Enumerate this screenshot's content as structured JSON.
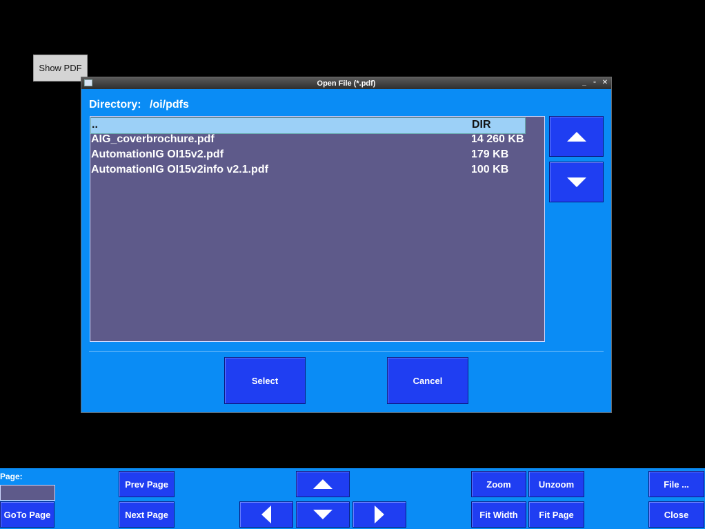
{
  "show_pdf_label": "Show PDF",
  "dialog": {
    "title": "Open File (*.pdf)",
    "directory_label": "Directory:",
    "directory_path": "/oi/pdfs",
    "files": [
      {
        "name": "..",
        "size": "DIR",
        "selected": true
      },
      {
        "name": "AIG_coverbrochure.pdf",
        "size": "14 260 KB"
      },
      {
        "name": "AutomationIG OI15v2.pdf",
        "size": "179 KB"
      },
      {
        "name": "AutomationIG OI15v2info v2.1.pdf",
        "size": "100 KB"
      }
    ],
    "select_label": "Select",
    "cancel_label": "Cancel"
  },
  "bottom_bar": {
    "page_label": "Page:",
    "page_value": "",
    "goto_page": "GoTo Page",
    "prev_page": "Prev Page",
    "next_page": "Next Page",
    "zoom": "Zoom",
    "unzoom": "Unzoom",
    "fit_width": "Fit Width",
    "fit_page": "Fit Page",
    "file": "File ...",
    "close": "Close"
  },
  "colors": {
    "background": "#000000",
    "panel": "#0a8cf5",
    "button": "#1f3ef2",
    "list": "#5e5a8a",
    "selection": "#9cd0f7"
  }
}
